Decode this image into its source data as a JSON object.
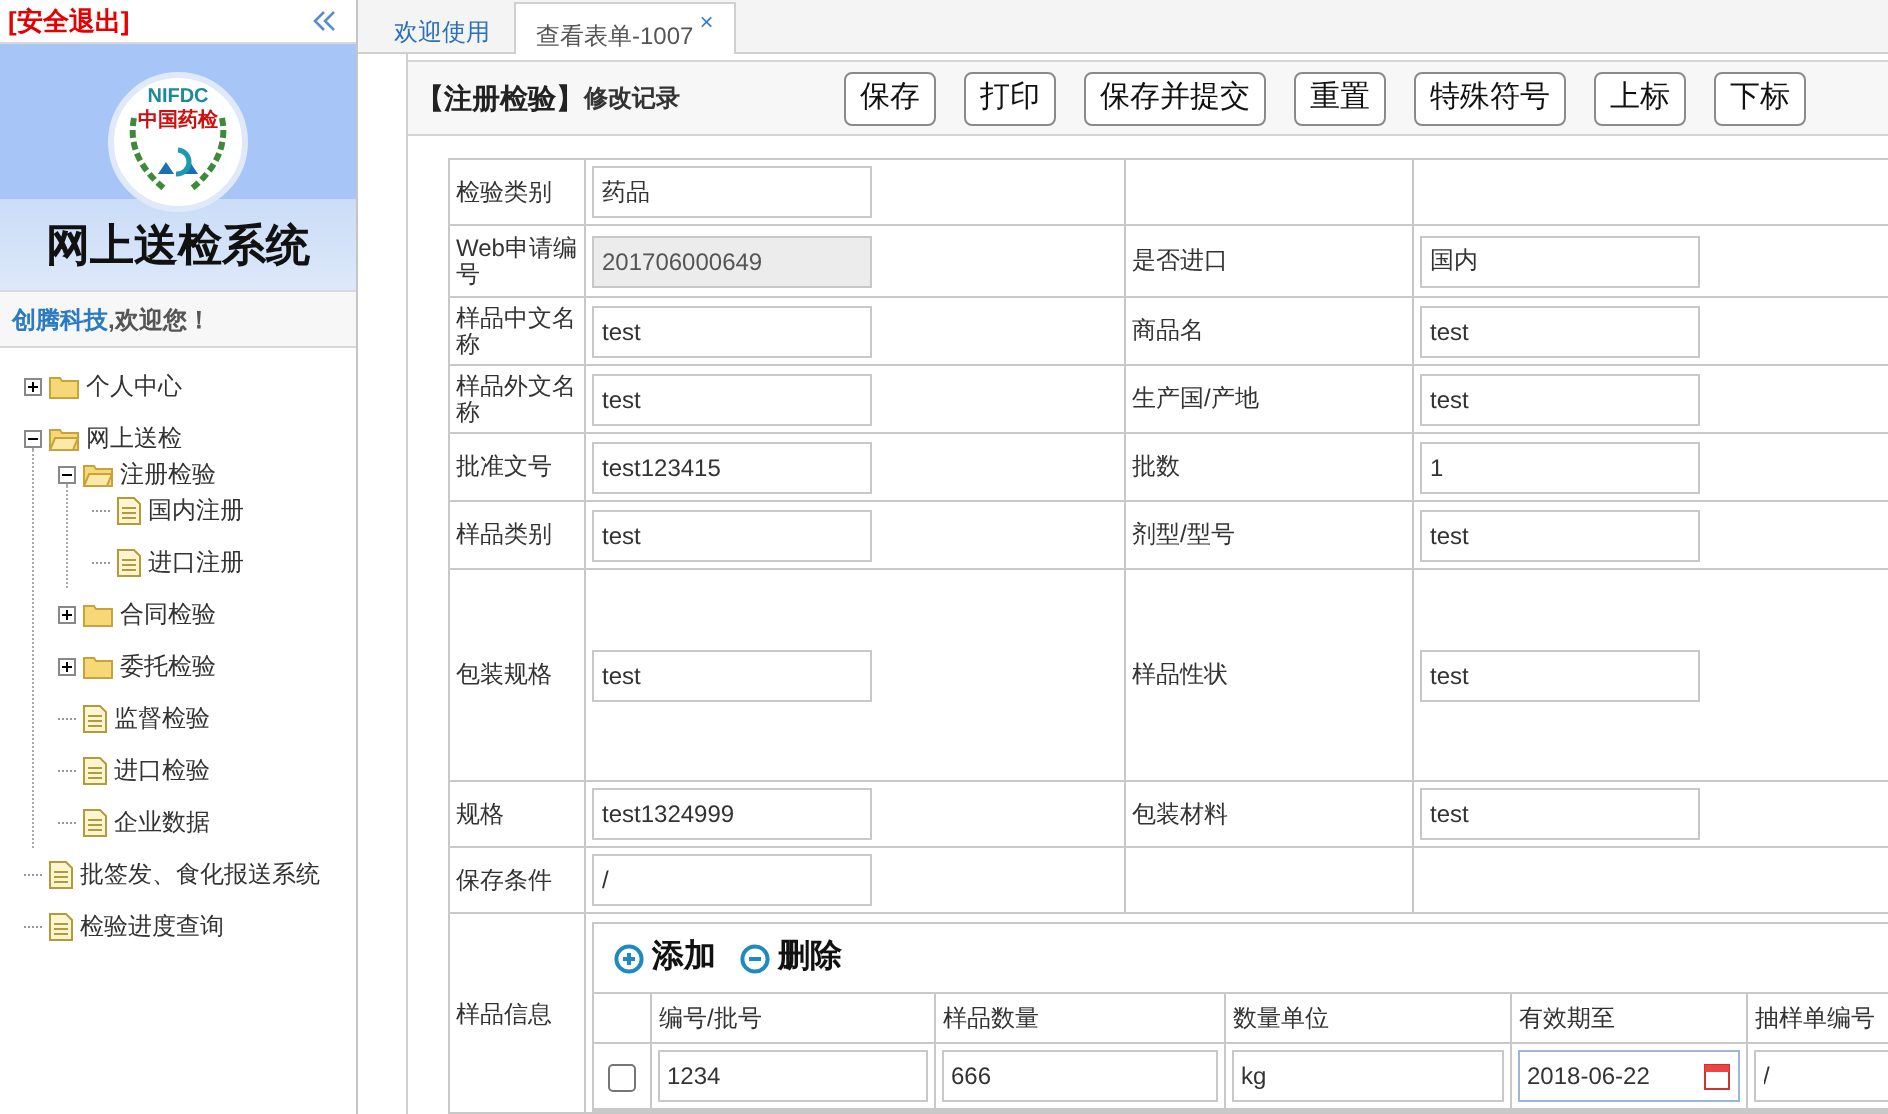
{
  "sidebar": {
    "logout": "[安全退出]",
    "logo": {
      "acronym": "NIFDC",
      "name": "中国药检"
    },
    "title": "网上送检系统",
    "welcome": {
      "company": "创腾科技",
      "greeting": ",欢迎您！"
    },
    "tree": [
      {
        "label": "个人中心",
        "kind": "folder",
        "expanded": false
      },
      {
        "label": "网上送检",
        "kind": "folder",
        "expanded": true,
        "children": [
          {
            "label": "注册检验",
            "kind": "folder",
            "expanded": true,
            "children": [
              {
                "label": "国内注册",
                "kind": "file"
              },
              {
                "label": "进口注册",
                "kind": "file"
              }
            ]
          },
          {
            "label": "合同检验",
            "kind": "folder",
            "expanded": false
          },
          {
            "label": "委托检验",
            "kind": "folder",
            "expanded": false
          },
          {
            "label": "监督检验",
            "kind": "file"
          },
          {
            "label": "进口检验",
            "kind": "file"
          },
          {
            "label": "企业数据",
            "kind": "file"
          }
        ]
      },
      {
        "label": "批签发、食化报送系统",
        "kind": "file"
      },
      {
        "label": "检验进度查询",
        "kind": "file"
      }
    ]
  },
  "tabs": [
    {
      "label": "欢迎使用",
      "selected": false
    },
    {
      "label": "查看表单-1007",
      "selected": true,
      "close": "×"
    }
  ],
  "toolbar": {
    "title": "【注册检验】",
    "subtitle": "修改记录",
    "buttons": [
      "保存",
      "打印",
      "保存并提交",
      "重置",
      "特殊符号",
      "上标",
      "下标"
    ]
  },
  "form": {
    "rows": [
      [
        {
          "label": "检验类别",
          "value": "药品",
          "disabled": false
        }
      ],
      [
        {
          "label": "Web申请编号",
          "value": "201706000649",
          "disabled": true
        },
        {
          "label": "是否进口",
          "value": "国内",
          "disabled": false
        }
      ],
      [
        {
          "label": "样品中文名称",
          "value": "test",
          "disabled": false
        },
        {
          "label": "商品名",
          "value": "test",
          "disabled": false
        }
      ],
      [
        {
          "label": "样品外文名称",
          "value": "test",
          "disabled": false
        },
        {
          "label": "生产国/产地",
          "value": "test",
          "disabled": false
        }
      ],
      [
        {
          "label": "批准文号",
          "value": "test123415",
          "disabled": false
        },
        {
          "label": "批数",
          "value": "1",
          "disabled": false
        }
      ],
      [
        {
          "label": "样品类别",
          "value": "test",
          "disabled": false
        },
        {
          "label": "剂型/型号",
          "value": "test",
          "disabled": false
        }
      ],
      [
        {
          "label": "包装规格",
          "value": "test",
          "disabled": false
        },
        {
          "label": "样品性状",
          "value": "test",
          "disabled": false
        }
      ],
      [
        {
          "label": "规格",
          "value": "test1324999",
          "disabled": false
        },
        {
          "label": "包装材料",
          "value": "test",
          "disabled": false
        }
      ],
      [
        {
          "label": "保存条件",
          "value": "/",
          "disabled": false
        }
      ]
    ],
    "samples": {
      "label": "样品信息",
      "actions": [
        {
          "label": "添加",
          "kind": "add"
        },
        {
          "label": "删除",
          "kind": "remove"
        }
      ],
      "columns": [
        {
          "label": "编号/批号",
          "kind": "text"
        },
        {
          "label": "样品数量",
          "kind": "text"
        },
        {
          "label": "数量单位",
          "kind": "text"
        },
        {
          "label": "有效期至",
          "kind": "date"
        },
        {
          "label": "抽样单编号",
          "kind": "text"
        }
      ],
      "rows": [
        {
          "checked": false,
          "cells": [
            "1234",
            "666",
            "kg",
            "2018-06-22",
            "/"
          ]
        }
      ]
    }
  }
}
